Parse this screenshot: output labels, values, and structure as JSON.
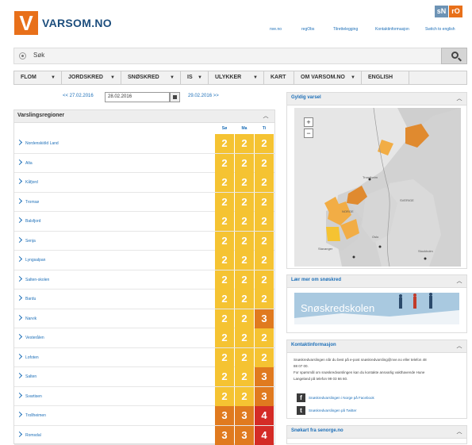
{
  "header": {
    "logo_letter": "V",
    "site_name": "VARSOM.NO",
    "top_links": [
      "nve.no",
      "regObs",
      "Tilrettelegging",
      "Kontaktinformasjon",
      "Switch to english"
    ],
    "brand_badges": [
      "sN",
      "rO"
    ]
  },
  "search": {
    "placeholder": "Søk"
  },
  "nav": [
    {
      "label": "FLOM",
      "dropdown": true
    },
    {
      "label": "JORDSKRED",
      "dropdown": true
    },
    {
      "label": "SNØSKRED",
      "dropdown": true
    },
    {
      "label": "IS",
      "dropdown": true
    },
    {
      "label": "ULYKKER",
      "dropdown": true
    },
    {
      "label": "KART",
      "dropdown": false
    },
    {
      "label": "OM VARSOM.NO",
      "dropdown": true
    },
    {
      "label": "ENGLISH",
      "dropdown": false
    }
  ],
  "datebar": {
    "prev": "<< 27.02.2016",
    "current": "28.02.2016",
    "next": "29.02.2016 >>"
  },
  "regions": {
    "title": "Varslingsregioner",
    "days": [
      "Sø",
      "Ma",
      "Ti"
    ],
    "rows": [
      {
        "name": "Nordenskiöld Land",
        "levels": [
          2,
          2,
          2
        ]
      },
      {
        "name": "Alta",
        "levels": [
          2,
          2,
          2
        ]
      },
      {
        "name": "Kåfjord",
        "levels": [
          2,
          2,
          2
        ]
      },
      {
        "name": "Tromsø",
        "levels": [
          2,
          2,
          2
        ]
      },
      {
        "name": "Balsfjord",
        "levels": [
          2,
          2,
          2
        ]
      },
      {
        "name": "Senja",
        "levels": [
          2,
          2,
          2
        ]
      },
      {
        "name": "Lyngsalpan",
        "levels": [
          2,
          2,
          2
        ]
      },
      {
        "name": "Salten-skolen",
        "levels": [
          2,
          2,
          2
        ]
      },
      {
        "name": "Bardu",
        "levels": [
          2,
          2,
          2
        ]
      },
      {
        "name": "Narvik",
        "levels": [
          2,
          2,
          3
        ]
      },
      {
        "name": "Vesterålen",
        "levels": [
          2,
          2,
          2
        ]
      },
      {
        "name": "Lofoten",
        "levels": [
          2,
          2,
          2
        ]
      },
      {
        "name": "Salten",
        "levels": [
          2,
          2,
          3
        ]
      },
      {
        "name": "Svartisen",
        "levels": [
          2,
          2,
          3
        ]
      },
      {
        "name": "Trollheimen",
        "levels": [
          3,
          3,
          4
        ]
      },
      {
        "name": "Romsdal",
        "levels": [
          3,
          3,
          4
        ]
      }
    ]
  },
  "level_colors": {
    "2": "#f5c332",
    "3": "#e07a1f",
    "4": "#d42b26"
  },
  "map_panel": {
    "title": "Gyldig varsel",
    "labels": [
      "Trondheim",
      "NORGE",
      "SVERIGE",
      "Oslo",
      "Stavanger",
      "Stockholm"
    ]
  },
  "learn_panel": {
    "title": "Lær mer om snøskred",
    "banner_text": "Snøskredskolen"
  },
  "contact_panel": {
    "title": "Kontaktinformasjon",
    "lines": [
      "Snøskredvarslingen når du best på e-post snøskredvarsling@nve.no eller telefon 48",
      "88 07 00.",
      "For spørsmål om snøskredvarslingen kan du kontakte ansvarlig vakthavende Hune",
      "Langeland på telefon 99 03 66 60."
    ],
    "social": [
      {
        "icon": "facebook-icon",
        "glyph": "f",
        "label": "Snøskredvarslingen i Norge på Facebook"
      },
      {
        "icon": "twitter-icon",
        "glyph": "t",
        "label": "Snøskredvarslingen på Twitter"
      }
    ]
  },
  "senorge_panel": {
    "title": "Snøkart fra senorge.no"
  }
}
